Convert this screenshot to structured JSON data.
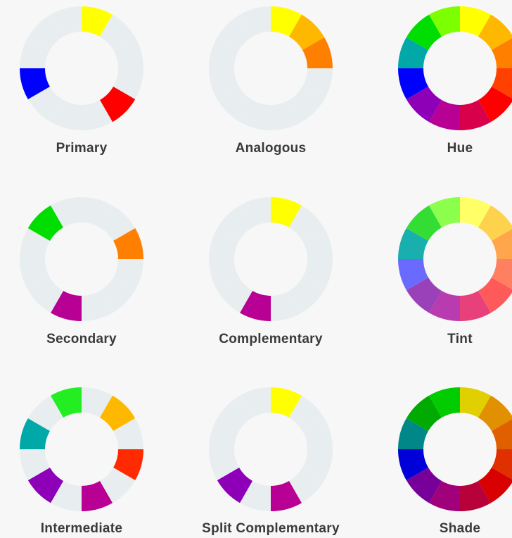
{
  "background": "#f7f7f7",
  "empty_segment_color": "#e8eeef",
  "wheels": [
    {
      "label": "Primary",
      "segments": [
        "#ffff00",
        "",
        "",
        "",
        "#ff0000",
        "",
        "",
        "",
        "#0000ff",
        "",
        "",
        ""
      ]
    },
    {
      "label": "Analogous",
      "segments": [
        "#ffff00",
        "#ffb800",
        "#ff8000",
        "",
        "",
        "",
        "",
        "",
        "",
        "",
        "",
        ""
      ]
    },
    {
      "label": "Hue",
      "segments": [
        "#ffff00",
        "#ffb800",
        "#ff8000",
        "#ff4000",
        "#ff0000",
        "#d8004a",
        "#b80094",
        "#8e00b8",
        "#0000ff",
        "#00a8a8",
        "#00dd00",
        "#7cff00"
      ]
    },
    {
      "label": "Secondary",
      "segments": [
        "",
        "",
        "#ff8000",
        "",
        "",
        "",
        "#b80094",
        "",
        "",
        "",
        "#00dd00",
        ""
      ]
    },
    {
      "label": "Complementary",
      "segments": [
        "#ffff00",
        "",
        "",
        "",
        "",
        "",
        "#b80094",
        "",
        "",
        "",
        "",
        ""
      ]
    },
    {
      "label": "Tint",
      "segments": [
        "#ffff66",
        "#ffd24d",
        "#ffa64d",
        "#ff8060",
        "#ff5a5a",
        "#e8407a",
        "#b83cb0",
        "#9a40b8",
        "#6a6aff",
        "#1aafaf",
        "#33dd33",
        "#8cff4d"
      ]
    },
    {
      "label": "Intermediate",
      "segments": [
        "",
        "#ffb800",
        "",
        "#ff2a00",
        "",
        "#b80094",
        "",
        "#8e00b8",
        "",
        "#00a8a8",
        "",
        "#22ee22"
      ]
    },
    {
      "label": "Split Complementary",
      "segments": [
        "#ffff00",
        "",
        "",
        "",
        "",
        "#b80094",
        "",
        "#8e00b8",
        "",
        "",
        "",
        ""
      ]
    },
    {
      "label": "Shade",
      "segments": [
        "#e0d000",
        "#e09000",
        "#e06000",
        "#e03000",
        "#d80000",
        "#b8003a",
        "#a0007a",
        "#78009a",
        "#0000d8",
        "#008888",
        "#00aa00",
        "#00cc00"
      ]
    }
  ]
}
